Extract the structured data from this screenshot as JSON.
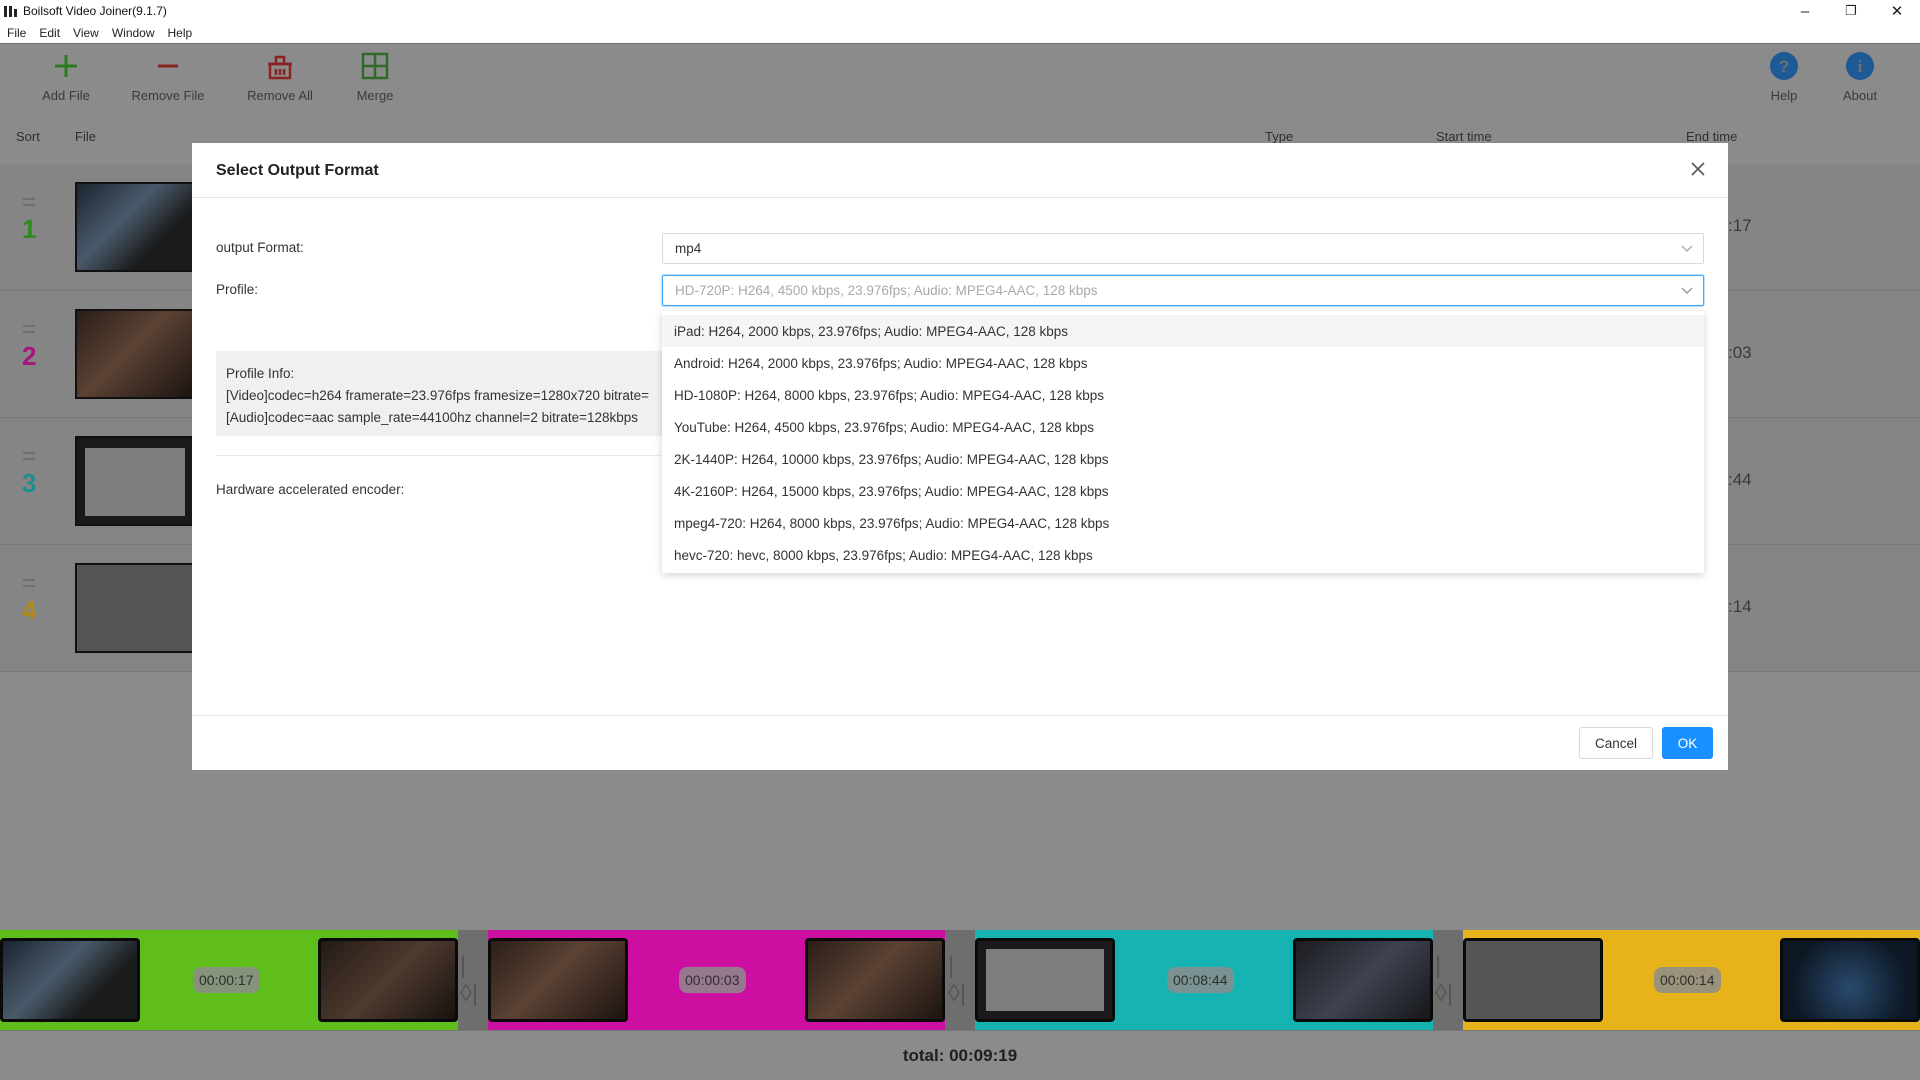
{
  "window": {
    "title": "Boilsoft Video Joiner(9.1.7)",
    "controls": [
      "–",
      "❐",
      "✕"
    ]
  },
  "menu": [
    "File",
    "Edit",
    "View",
    "Window",
    "Help"
  ],
  "toolbar": {
    "add_file": "Add File",
    "remove_file": "Remove File",
    "remove_all": "Remove All",
    "merge": "Merge",
    "help": "Help",
    "about": "About"
  },
  "list_header": {
    "sort": "Sort",
    "file": "File",
    "type": "Type",
    "start_time": "Start time",
    "end_time": "End time"
  },
  "rows": [
    {
      "num": "1",
      "end": ":17",
      "color": "#2e8b1c"
    },
    {
      "num": "2",
      "end": ":03",
      "color": "#a3157f"
    },
    {
      "num": "3",
      "end": ":44",
      "color": "#1e8d8d"
    },
    {
      "num": "4",
      "end": ":14",
      "color": "#b48a14"
    }
  ],
  "timeline": [
    {
      "time": "00:00:17",
      "color": "#5fbe1a"
    },
    {
      "time": "00:00:03",
      "color": "#cc0fa0"
    },
    {
      "time": "00:08:44",
      "color": "#16b3b3"
    },
    {
      "time": "00:00:14",
      "color": "#e7b31b"
    }
  ],
  "total": "total: 00:09:19",
  "dialog": {
    "title": "Select Output Format",
    "close": "X",
    "output_format_label": "output Format:",
    "output_format_value": "mp4",
    "profile_label": "Profile:",
    "profile_value": "HD-720P: H264, 4500 kbps, 23.976fps; Audio: MPEG4-AAC, 128 kbps",
    "profile_info_title": "Profile Info:",
    "profile_info_video": "[Video]codec=h264 framerate=23.976fps framesize=1280x720 bitrate=",
    "profile_info_audio": "[Audio]codec=aac sample_rate=44100hz channel=2 bitrate=128kbps",
    "hw_encoder_label": "Hardware accelerated encoder:",
    "cancel": "Cancel",
    "ok": "OK",
    "profile_options": [
      "iPad: H264, 2000 kbps, 23.976fps; Audio: MPEG4-AAC, 128 kbps",
      "Android: H264, 2000 kbps, 23.976fps; Audio: MPEG4-AAC, 128 kbps",
      "HD-1080P: H264, 8000 kbps, 23.976fps; Audio: MPEG4-AAC, 128 kbps",
      "YouTube: H264, 4500 kbps, 23.976fps; Audio: MPEG4-AAC, 128 kbps",
      "2K-1440P: H264, 10000 kbps, 23.976fps; Audio: MPEG4-AAC, 128 kbps",
      "4K-2160P: H264, 15000 kbps, 23.976fps; Audio: MPEG4-AAC, 128 kbps",
      "mpeg4-720: H264, 8000 kbps, 23.976fps; Audio: MPEG4-AAC, 128 kbps",
      "hevc-720: hevc, 8000 kbps, 23.976fps; Audio: MPEG4-AAC, 128 kbps"
    ]
  }
}
